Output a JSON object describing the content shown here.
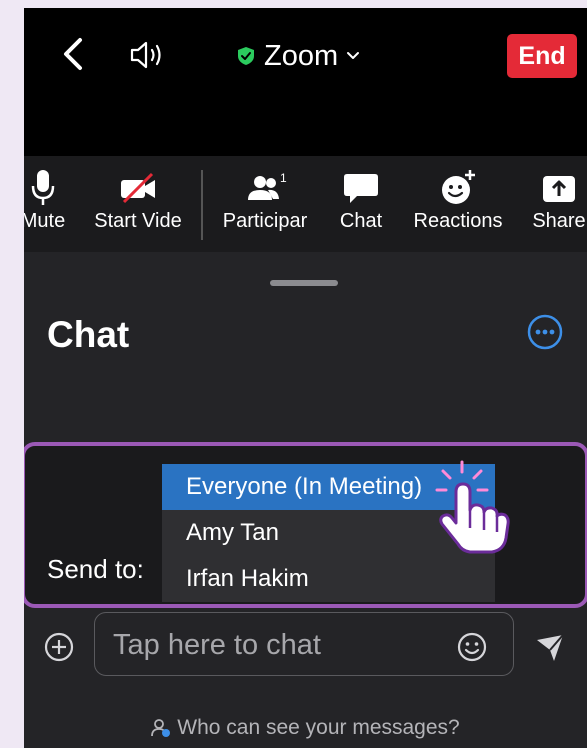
{
  "header": {
    "title": "Zoom",
    "end_label": "End"
  },
  "toolbar": {
    "items": [
      {
        "label": "Mute",
        "icon": "microphone-icon"
      },
      {
        "label": "Start Vide",
        "icon": "video-off-icon"
      },
      {
        "label": "Participar",
        "icon": "participants-icon",
        "badge": "1"
      },
      {
        "label": "Chat",
        "icon": "chat-bubble-icon"
      },
      {
        "label": "Reactions",
        "icon": "reaction-emoji-icon"
      },
      {
        "label": "Share",
        "icon": "share-arrow-icon"
      }
    ]
  },
  "chat": {
    "title": "Chat",
    "send_to_label": "Send to:",
    "recipients": [
      {
        "label": "Everyone (In Meeting)",
        "selected": true
      },
      {
        "label": "Amy Tan",
        "selected": false
      },
      {
        "label": "Irfan Hakim",
        "selected": false
      }
    ],
    "input_placeholder": "Tap here to chat",
    "visibility_link": "Who can see your messages?"
  },
  "colors": {
    "end_button": "#e42a37",
    "secure_shield": "#2bcb5e",
    "selected_recipient": "#2a73c2",
    "highlight_border": "#9b59b6",
    "link_blue": "#3d8fe8"
  }
}
